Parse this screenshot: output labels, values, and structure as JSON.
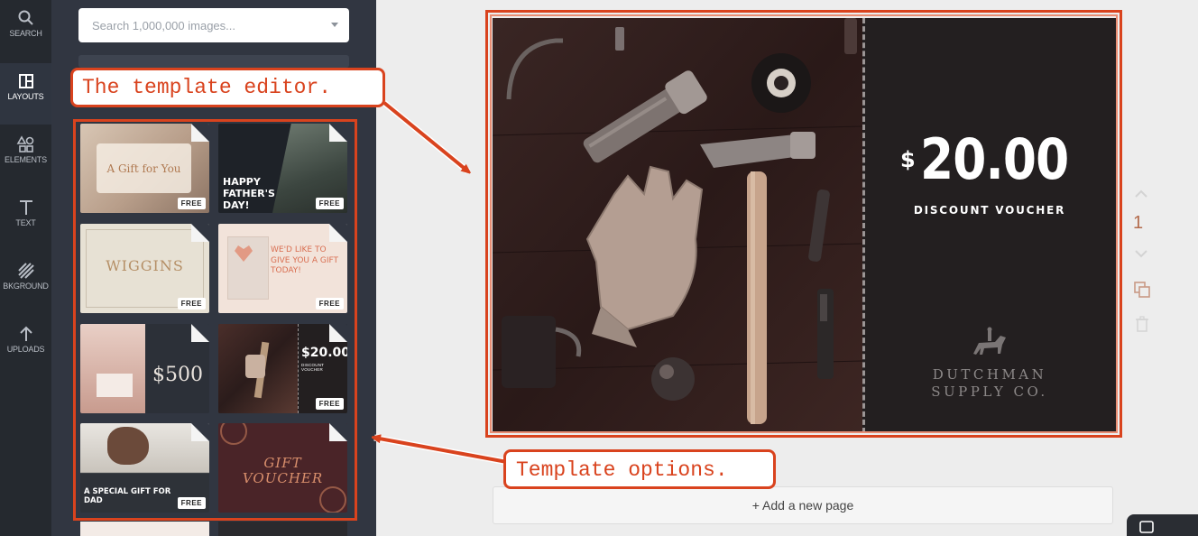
{
  "sidebar": {
    "items": [
      {
        "label": "SEARCH",
        "icon": "search-icon"
      },
      {
        "label": "LAYOUTS",
        "icon": "layouts-icon"
      },
      {
        "label": "ELEMENTS",
        "icon": "elements-icon"
      },
      {
        "label": "TEXT",
        "icon": "text-icon"
      },
      {
        "label": "BKGROUND",
        "icon": "background-icon"
      },
      {
        "label": "UPLOADS",
        "icon": "uploads-icon"
      }
    ],
    "active": "LAYOUTS"
  },
  "search": {
    "placeholder": "Search 1,000,000 images..."
  },
  "templates": [
    {
      "text": "A Gift for You",
      "badge": "FREE"
    },
    {
      "text": "HAPPY FATHER'S DAY!",
      "badge": "FREE"
    },
    {
      "text": "WIGGINS",
      "badge": "FREE"
    },
    {
      "text": "WE'D LIKE TO GIVE YOU A GIFT TODAY!",
      "badge": "FREE"
    },
    {
      "text": "$500",
      "badge": ""
    },
    {
      "text": "$20.00",
      "subtext": "DISCOUNT VOUCHER",
      "badge": "FREE"
    },
    {
      "text": "A SPECIAL GIFT FOR DAD",
      "badge": "FREE"
    },
    {
      "text": "GIFT VOUCHER",
      "badge": ""
    }
  ],
  "design": {
    "currency": "$",
    "amount": "20.00",
    "label": "DISCOUNT VOUCHER",
    "brand": "DUTCHMAN\nSUPPLY CO."
  },
  "page_number": "1",
  "add_page_label": "+ Add a new page",
  "annotations": {
    "editor": "The template editor.",
    "options": "Template options."
  },
  "colors": {
    "annotation": "#d9431e",
    "rail": "#25292f",
    "panel": "#313641",
    "voucher": "#231f20"
  }
}
